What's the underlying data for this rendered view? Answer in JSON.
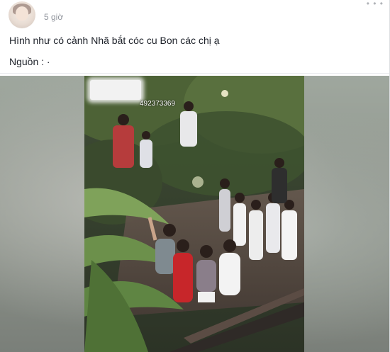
{
  "post": {
    "time": "5 giờ",
    "text_line1": "Hình như có cảnh Nhã bắt cóc cu Bon các chị ạ",
    "text_line2": "Nguồn : ·",
    "more_icon": "more-dots-icon"
  },
  "video": {
    "overlay_number": "492373369"
  }
}
